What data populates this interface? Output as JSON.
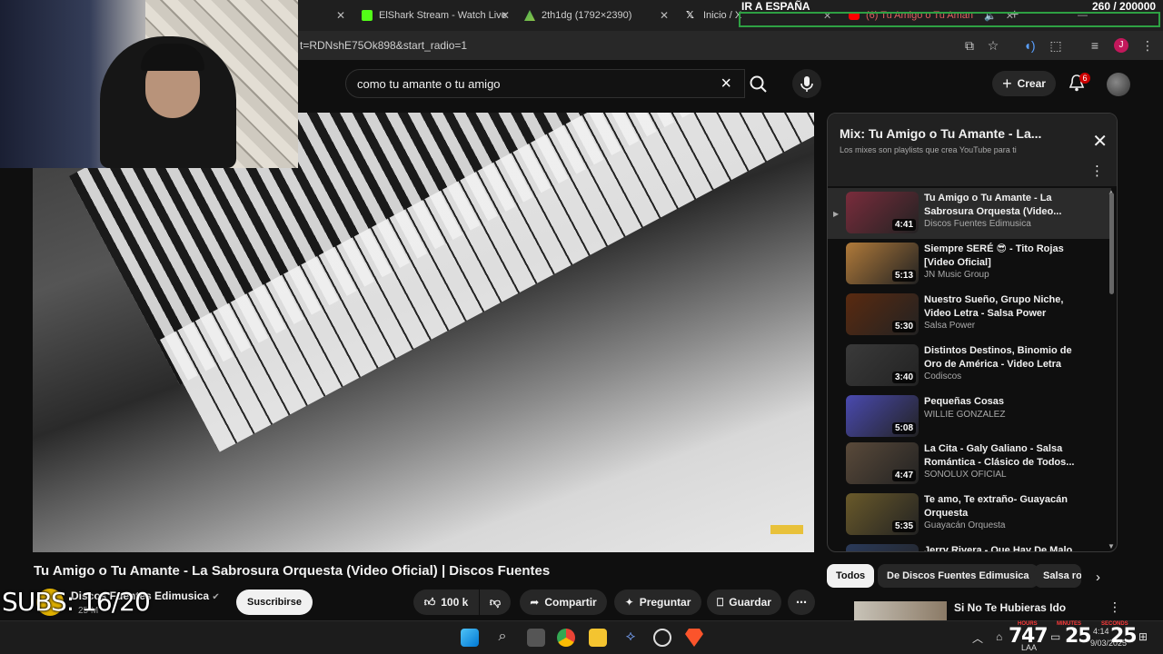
{
  "browser": {
    "tabs": [
      {
        "label": "ElShark Stream - Watch Live",
        "icon": "kick-icon"
      },
      {
        "label": "2th1dg (1792×2390)",
        "icon": "image-icon"
      },
      {
        "label": "Inicio / X",
        "icon": "x-icon"
      },
      {
        "label": "(6) Tu Amigo o Tu Aman",
        "icon": "youtube-icon"
      }
    ],
    "url": "t=RDNshE75Ok898&start_radio=1",
    "profile_initial": "J"
  },
  "overlay": {
    "title": "IR A ESPAÑA",
    "counter": "260  / 200000",
    "subs": "SUBS: 16/20"
  },
  "youtube": {
    "search_value": "como tu amante o tu amigo",
    "create_label": "Crear",
    "notification_count": "6"
  },
  "video": {
    "title": "Tu Amigo o Tu Amante - La Sabrosura Orquesta (Video Oficial) | Discos Fuentes",
    "channel": "Discos Fuentes Edimusica",
    "subscribers": "25 M",
    "subscribe_label": "Suscribirse",
    "likes": "100 k",
    "share_label": "Compartir",
    "ask_label": "Preguntar",
    "save_label": "Guardar"
  },
  "playlist": {
    "title": "Mix: Tu Amigo o Tu Amante - La...",
    "subtitle": "Los mixes son playlists que crea YouTube para ti",
    "items": [
      {
        "title": "Tu Amigo o Tu Amante - La Sabrosura Orquesta (Video...",
        "channel": "Discos Fuentes Edimusica",
        "duration": "4:41",
        "color": "#7a2c3c"
      },
      {
        "title": "Siempre SERÉ 😎 - Tito Rojas [Video Oficial]",
        "channel": "JN Music Group",
        "duration": "5:13",
        "color": "#b07a3a"
      },
      {
        "title": "Nuestro Sueño, Grupo Niche, Video Letra - Salsa Power",
        "channel": "Salsa Power",
        "duration": "5:30",
        "color": "#5a2a10"
      },
      {
        "title": "Distintos Destinos, Binomio de Oro de América - Video Letra",
        "channel": "Codiscos",
        "duration": "3:40",
        "color": "#3a3a3a"
      },
      {
        "title": "Pequeñas Cosas",
        "channel": "WILLIE GONZALEZ",
        "duration": "5:08",
        "color": "#4a4ab0"
      },
      {
        "title": "La Cita - Galy Galiano - Salsa Romántica - Clásico de Todos...",
        "channel": "SONOLUX OFICIAL",
        "duration": "4:47",
        "color": "#5a4a3a"
      },
      {
        "title": "Te amo, Te extraño- Guayacán Orquesta",
        "channel": "Guayacán Orquesta",
        "duration": "5:35",
        "color": "#6a5a2a"
      },
      {
        "title": "Jerry Rivera - Que Hay De Malo",
        "channel": "",
        "duration": "",
        "color": "#2a3a5a"
      }
    ]
  },
  "chips": [
    "Todos",
    "De Discos Fuentes Edimusica",
    "Salsa ro"
  ],
  "recommendation": {
    "title": "Si No Te Hubieras Ido"
  },
  "taskbar": {
    "clock_hours": "7",
    "clock_minutes": "47",
    "clock_seconds": "25",
    "clock_seconds2": "25",
    "hours_label": "HOURS",
    "minutes_label": "MINUTES",
    "seconds_label": "SECONDS",
    "time": "4:14",
    "date": "9/03/2025",
    "region": "LAA"
  }
}
